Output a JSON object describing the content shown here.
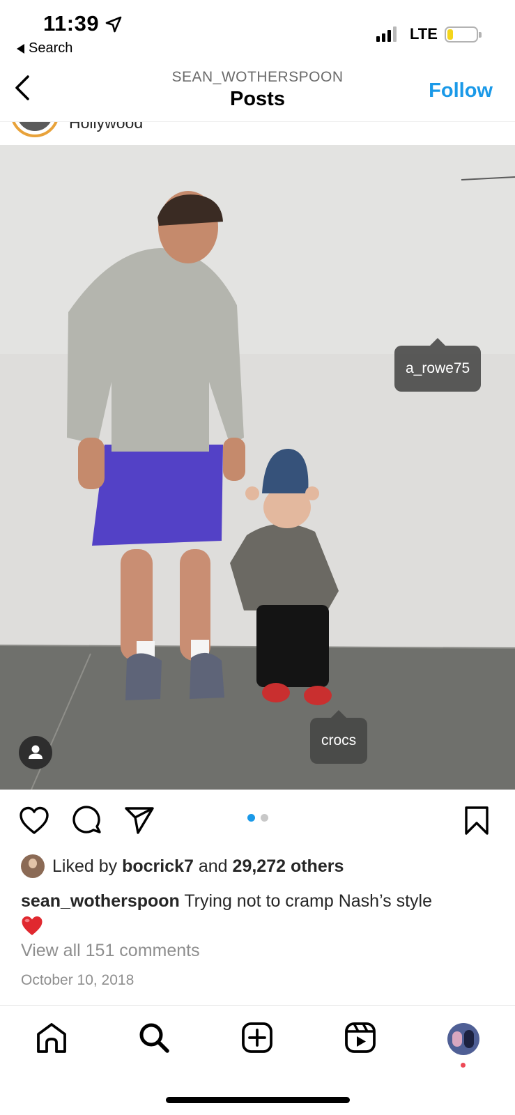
{
  "status_bar": {
    "time": "11:39",
    "back_label": "Search",
    "network": "LTE"
  },
  "header": {
    "username": "SEAN_WOTHERSPOON",
    "title": "Posts",
    "follow_label": "Follow"
  },
  "post": {
    "location": "Hollywood",
    "tags": [
      "a_rowe75",
      "crocs"
    ],
    "carousel": {
      "count": 2,
      "active_index": 0
    },
    "liked_by_prefix": "Liked by",
    "liked_by_user": "bocrick7",
    "liked_by_and": "and",
    "likes_count": "29,272 others",
    "caption_user": "sean_wotherspoon",
    "caption_text": "Trying not to cramp Nash’s style",
    "caption_emoji": "red-heart",
    "view_comments": "View all 151 comments",
    "date": "October 10, 2018"
  },
  "icons": {
    "like": "heart-icon",
    "comment": "comment-icon",
    "share": "send-icon",
    "save": "bookmark-icon",
    "tabs": [
      "home-icon",
      "search-icon",
      "add-post-icon",
      "reels-icon",
      "profile-avatar"
    ]
  },
  "colors": {
    "accent": "#1a99e8",
    "tag_bg": "#464644",
    "muted": "#8e8e8e",
    "notification": "#ed4956"
  }
}
